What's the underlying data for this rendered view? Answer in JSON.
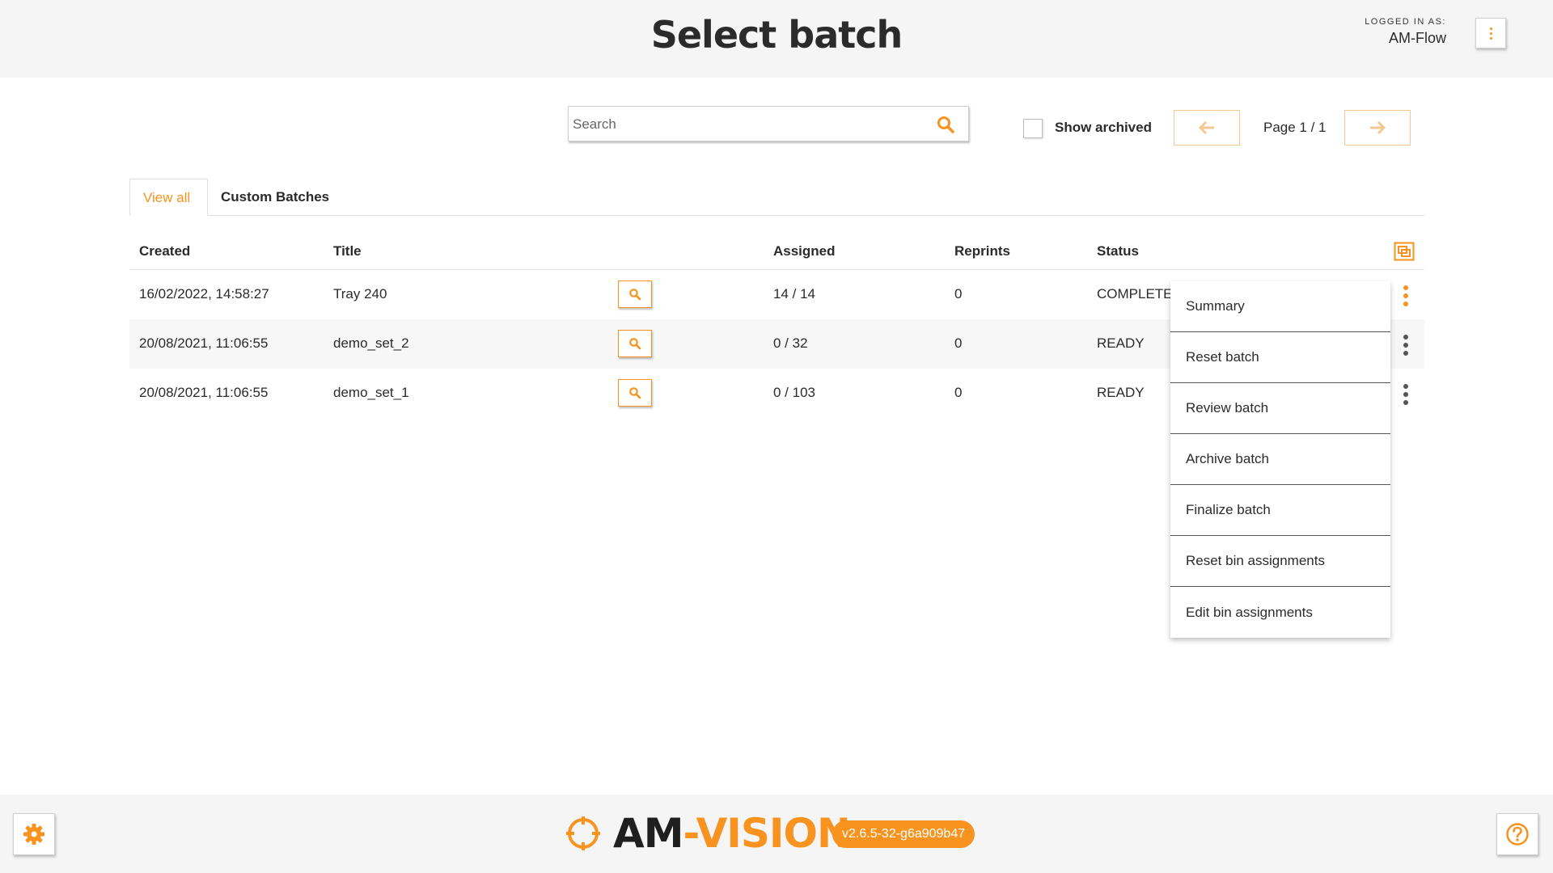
{
  "header": {
    "title": "Select batch",
    "login_label": "LOGGED IN AS:",
    "login_user": "AM-Flow"
  },
  "toolbar": {
    "search_placeholder": "Search",
    "search_value": "",
    "show_archived_label": "Show archived",
    "show_archived_checked": false,
    "page_label": "Page 1 / 1"
  },
  "tabs": [
    {
      "label": "View all",
      "active": true
    },
    {
      "label": "Custom Batches",
      "active": false
    }
  ],
  "table": {
    "columns": [
      "Created",
      "Title",
      "Assigned",
      "Reprints",
      "Status"
    ],
    "rows": [
      {
        "created": "16/02/2022, 14:58:27",
        "title": "Tray 240",
        "assigned": "14 / 14",
        "reprints": "0",
        "status": "COMPLETE"
      },
      {
        "created": "20/08/2021, 11:06:55",
        "title": "demo_set_2",
        "assigned": "0 / 32",
        "reprints": "0",
        "status": "READY"
      },
      {
        "created": "20/08/2021, 11:06:55",
        "title": "demo_set_1",
        "assigned": "0 / 103",
        "reprints": "0",
        "status": "READY"
      }
    ]
  },
  "row_menu": {
    "items": [
      "Summary",
      "Reset batch",
      "Review batch",
      "Archive batch",
      "Finalize batch",
      "Reset bin assignments",
      "Edit bin assignments"
    ]
  },
  "footer": {
    "logo_am": "AM",
    "logo_vision": "-VISION",
    "version": "v2.6.5-32-g6a909b47"
  },
  "colors": {
    "accent": "#f7931e",
    "header_bg": "#f5f5f5",
    "text": "#2b2b2b"
  },
  "icons": {
    "search": "search-icon",
    "prev": "arrow-left-icon",
    "next": "arrow-right-icon",
    "preview": "magnifier-icon",
    "row_menu": "vertical-dots-icon",
    "column_toggle": "column-select-icon",
    "settings": "gear-icon",
    "help": "question-circle-icon",
    "logo": "crosshair-icon"
  }
}
